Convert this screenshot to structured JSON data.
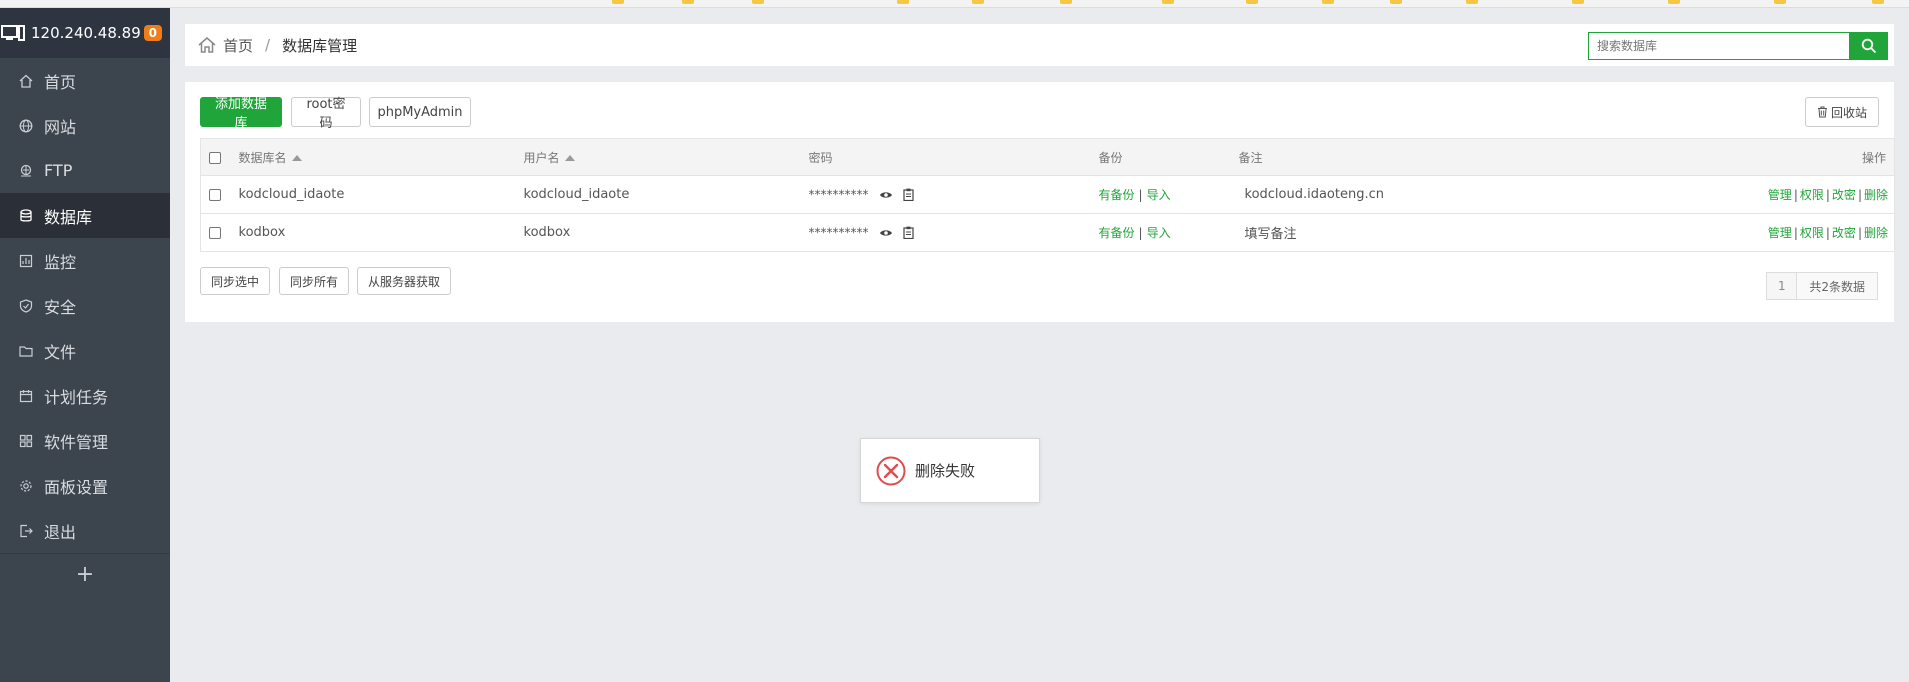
{
  "sidebar": {
    "server_ip": "120.240.48.89",
    "badge": "0",
    "items": [
      {
        "label": "首页",
        "icon": "home-icon"
      },
      {
        "label": "网站",
        "icon": "globe-icon"
      },
      {
        "label": "FTP",
        "icon": "ftp-icon"
      },
      {
        "label": "数据库",
        "icon": "database-icon",
        "active": true
      },
      {
        "label": "监控",
        "icon": "monitor-icon"
      },
      {
        "label": "安全",
        "icon": "shield-icon"
      },
      {
        "label": "文件",
        "icon": "folder-icon"
      },
      {
        "label": "计划任务",
        "icon": "calendar-icon"
      },
      {
        "label": "软件管理",
        "icon": "grid-icon"
      },
      {
        "label": "面板设置",
        "icon": "gear-icon"
      },
      {
        "label": "退出",
        "icon": "logout-icon"
      }
    ],
    "add_label": "+"
  },
  "breadcrumb": {
    "home": "首页",
    "separator": "/",
    "current": "数据库管理"
  },
  "search": {
    "placeholder": "搜索数据库"
  },
  "toolbar": {
    "add_db": "添加数据库",
    "root_pw": "root密码",
    "phpmyadmin": "phpMyAdmin",
    "recycle": "回收站"
  },
  "table": {
    "headers": {
      "name": "数据库名",
      "user": "用户名",
      "password": "密码",
      "backup": "备份",
      "note": "备注",
      "ops": "操作"
    },
    "rows": [
      {
        "name": "kodcloud_idaote",
        "user": "kodcloud_idaote",
        "password": "**********",
        "backup": "有备份",
        "import": "导入",
        "note": "kodcloud.idaoteng.cn",
        "ops": [
          "管理",
          "权限",
          "改密",
          "删除"
        ]
      },
      {
        "name": "kodbox",
        "user": "kodbox",
        "password": "**********",
        "backup": "有备份",
        "import": "导入",
        "note": "填写备注",
        "ops": [
          "管理",
          "权限",
          "改密",
          "删除"
        ]
      }
    ]
  },
  "bottom": {
    "sync_selected": "同步选中",
    "sync_all": "同步所有",
    "fetch_server": "从服务器获取"
  },
  "pager": {
    "page": "1",
    "total": "共2条数据"
  },
  "toast": {
    "message": "删除失败"
  },
  "colors": {
    "accent": "#20a53a",
    "sidebar": "#3c444d",
    "badge": "#f07d19",
    "error": "#e34c4c"
  }
}
